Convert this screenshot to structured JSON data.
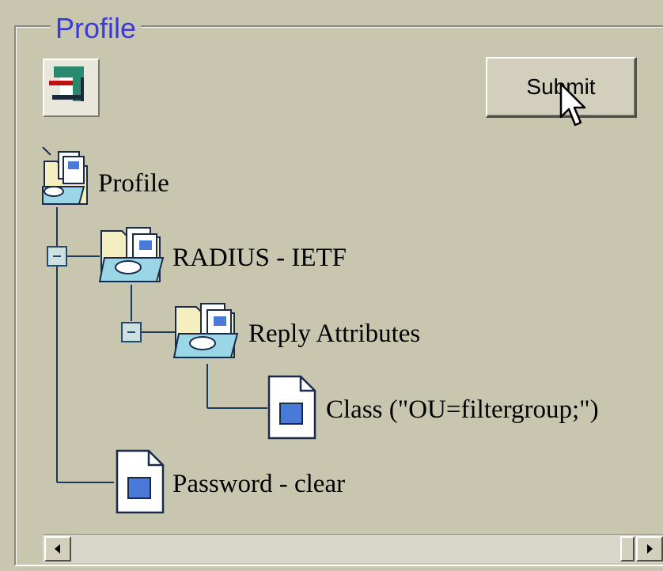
{
  "groupbox": {
    "title": "Profile"
  },
  "toolbar": {
    "tool_icon": "profile-tool-icon",
    "submit_label": "Submit"
  },
  "tree": {
    "root": {
      "label": "Profile",
      "icon": "profile-folder-icon"
    },
    "radius": {
      "label": "RADIUS - IETF",
      "icon": "folder-open-icon",
      "expanded": true
    },
    "reply": {
      "label": "Reply Attributes",
      "icon": "folder-open-icon",
      "expanded": true
    },
    "class_attr": {
      "label": "Class (\"OU=filtergroup;\")",
      "icon": "document-icon"
    },
    "password": {
      "label": "Password - clear",
      "icon": "document-icon"
    }
  },
  "scrollbar": {
    "left_icon": "arrow-left-icon",
    "right_icon": "arrow-right-icon"
  },
  "colors": {
    "background": "#c9c6b0",
    "legend": "#3a3ae0",
    "tree_line": "#1a3a5a",
    "doc_fill": "#4a7ad8"
  }
}
